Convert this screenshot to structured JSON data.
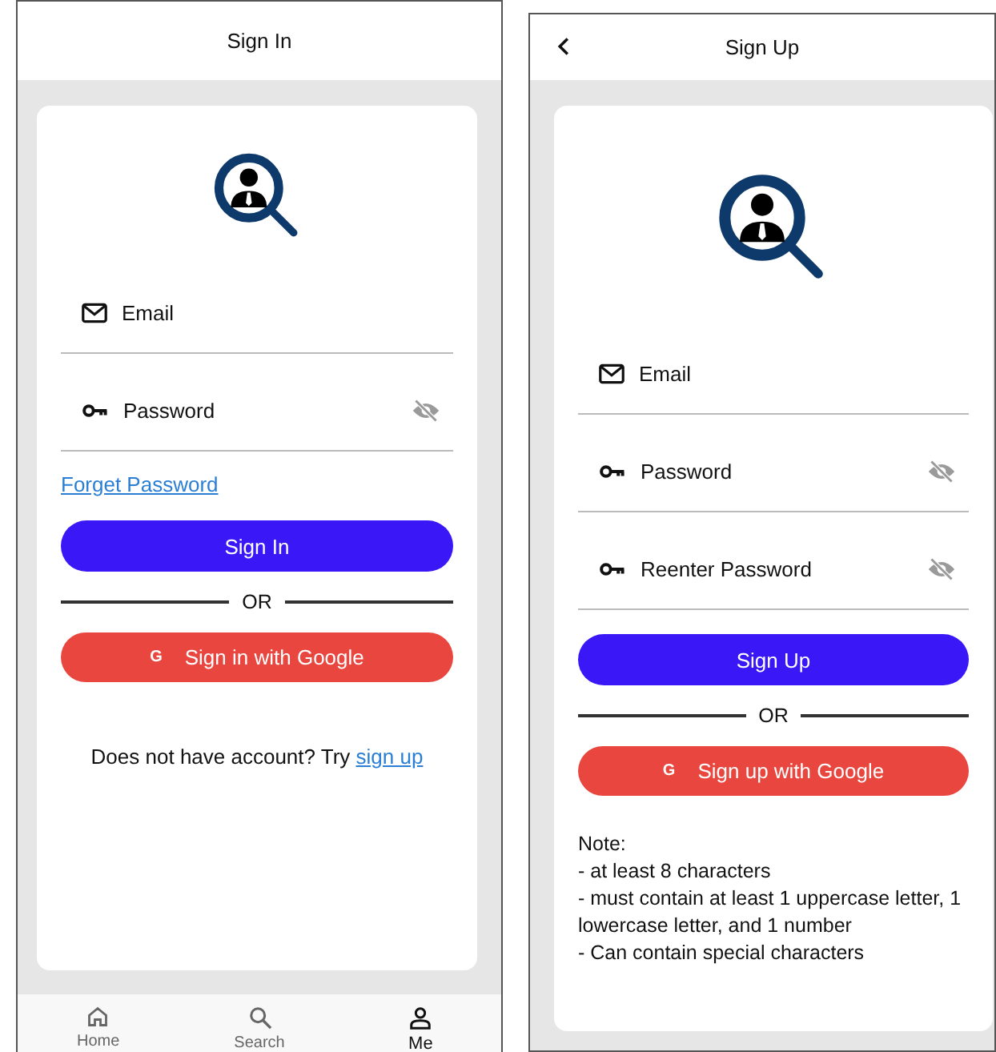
{
  "screens": [
    {
      "kind": "sign_in",
      "title": "Sign In",
      "back": false,
      "fields": [
        {
          "kind": "email",
          "placeholder": "Email"
        },
        {
          "kind": "password",
          "placeholder": "Password"
        }
      ],
      "forgot_link": "Forget Password",
      "primary_button": "Sign In",
      "divider": "OR",
      "google_button": {
        "icon": "G",
        "label": "Sign in with Google"
      },
      "footer": {
        "text": "Does not have account? Try",
        "link": "sign up"
      },
      "nav": [
        {
          "kind": "home",
          "label": "Home",
          "selected": false
        },
        {
          "kind": "search",
          "label": "Search",
          "selected": false
        },
        {
          "kind": "profile",
          "label": "Me",
          "selected": true
        }
      ]
    },
    {
      "kind": "sign_up",
      "title": "Sign Up",
      "back": true,
      "fields": [
        {
          "kind": "email",
          "placeholder": "Email"
        },
        {
          "kind": "password",
          "placeholder": "Password"
        },
        {
          "kind": "password",
          "placeholder": "Reenter Password"
        }
      ],
      "primary_button": "Sign Up",
      "divider": "OR",
      "google_button": {
        "icon": "G",
        "label": "Sign up with Google"
      },
      "note": {
        "title": "Note:",
        "lines": [
          "- at least 8 characters",
          "- must contain at least 1 uppercase letter, 1 lowercase letter, and 1 number",
          "- Can contain special characters"
        ]
      }
    }
  ]
}
